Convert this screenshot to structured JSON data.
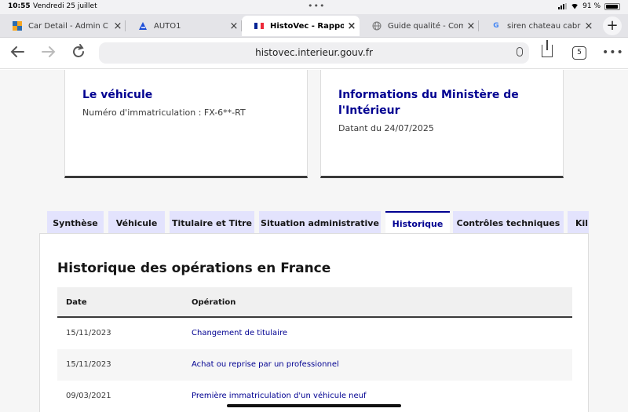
{
  "status_bar": {
    "time": "10:55",
    "date": "Vendredi 25 juillet",
    "dots": "•••",
    "battery": "91 %",
    "battery_level": 0.91
  },
  "browser": {
    "tabs": [
      {
        "title": "Car Detail - Admin C",
        "icon": "car-detail-favicon",
        "active": false
      },
      {
        "title": "AUTO1",
        "icon": "auto1-favicon",
        "active": false
      },
      {
        "title": "HistoVec - Rapport v",
        "icon": "french-flag-favicon",
        "active": true
      },
      {
        "title": "Guide qualité - Com",
        "icon": "globe-favicon",
        "active": false
      },
      {
        "title": "siren chateau cabrie",
        "icon": "google-favicon",
        "active": false
      }
    ],
    "close_glyph": "×",
    "new_tab_glyph": "+",
    "url": "histovec.interieur.gouv.fr",
    "tab_count": "5",
    "more_glyph": "•••"
  },
  "cards": {
    "vehicle": {
      "title": "Le véhicule",
      "text": "Numéro d'immatriculation : FX-6**-RT"
    },
    "ministry": {
      "title": "Informations du Ministère de l'Intérieur",
      "text": "Datant du 24/07/2025"
    }
  },
  "page_tabs": [
    "Synthèse",
    "Véhicule",
    "Titulaire et Titre",
    "Situation administrative",
    "Historique",
    "Contrôles techniques",
    "Kil"
  ],
  "selected_tab": "Historique",
  "history": {
    "title": "Historique des opérations en France",
    "headers": {
      "date": "Date",
      "operation": "Opération"
    },
    "rows": [
      {
        "date": "15/11/2023",
        "operation": "Changement de titulaire"
      },
      {
        "date": "15/11/2023",
        "operation": "Achat ou reprise par un professionnel"
      },
      {
        "date": "09/03/2021",
        "operation": "Première immatriculation d'un véhicule neuf"
      }
    ]
  },
  "colors": {
    "accent": "#000091",
    "tab_bg": "#e3e3fd",
    "card_border": "#3a3a3a"
  }
}
